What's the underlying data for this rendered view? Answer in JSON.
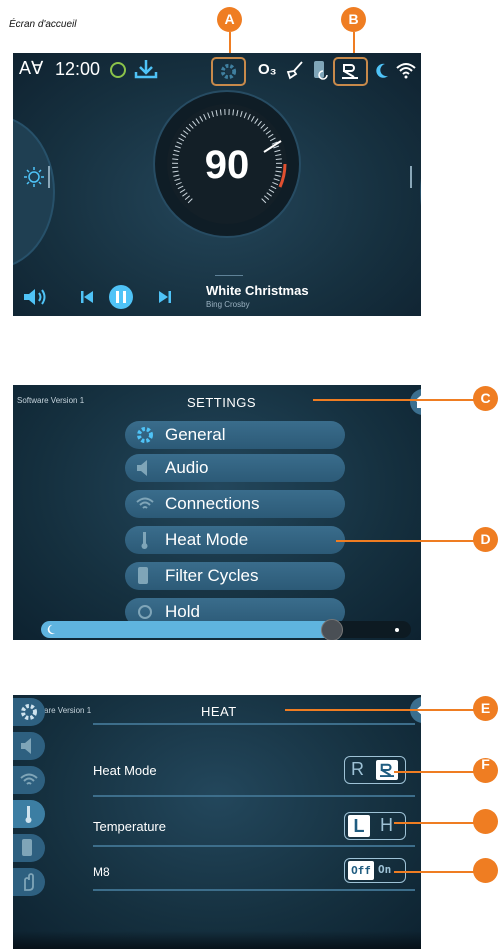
{
  "caption": "Écran d'accueil",
  "markers": {
    "a": "A",
    "b": "B",
    "c": "C",
    "d": "D",
    "e": "E",
    "f": "F"
  },
  "home": {
    "time": "12:00",
    "ozone": "O₃",
    "temperature": "90",
    "song_title": "White Christmas",
    "artist": "Bing Crosby",
    "accent": "#4fc3f7"
  },
  "settings": {
    "version": "Software Version 1",
    "title": "SETTINGS",
    "items": [
      "General",
      "Audio",
      "Connections",
      "Heat Mode",
      "Filter Cycles",
      "Hold"
    ],
    "brightness_level": 0.79
  },
  "heat": {
    "version": "Software Version 1",
    "title": "HEAT",
    "rows": [
      {
        "label": "Heat Mode",
        "left": "R",
        "right": "R̲"
      },
      {
        "label": "Temperature",
        "left": "L",
        "right": "H"
      },
      {
        "label": "M8",
        "left": "Off",
        "right": "On"
      }
    ]
  }
}
